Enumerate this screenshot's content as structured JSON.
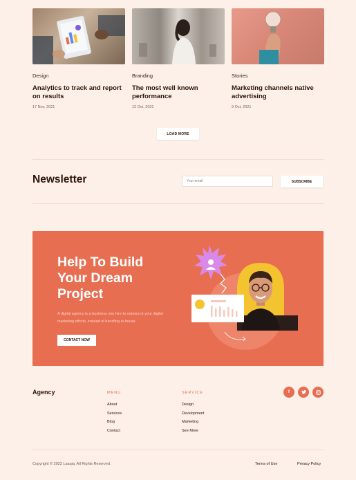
{
  "articles": [
    {
      "category": "Design",
      "title": "Analytics to track and report on results",
      "date": "17 Nov, 2021",
      "image": "tablet-analytics-photo"
    },
    {
      "category": "Branding",
      "title": "The most well known performance",
      "date": "12 Oct, 2021",
      "image": "woman-back-photo"
    },
    {
      "category": "Stories",
      "title": "Marketing channels native advertising",
      "date": "9 Oct, 2021",
      "image": "lightbulb-hand-photo"
    }
  ],
  "load_more": "LOAD MORE",
  "newsletter": {
    "title": "Newsletter",
    "placeholder": "Your email",
    "button": "SUBSCRIBE"
  },
  "cta": {
    "title": "Help To Build Your Dream Project",
    "text": "A digital agency is a business you hire to outsource your digital marketing efforts, instead of handling in-house.",
    "button": "CONTACT NOW"
  },
  "footer": {
    "brand": "Agency",
    "menu": {
      "heading": "MENU",
      "links": [
        "About",
        "Services",
        "Blog",
        "Contact"
      ]
    },
    "service": {
      "heading": "SERVICE",
      "links": [
        "Design",
        "Development",
        "Marketing",
        "See More"
      ]
    },
    "socials": [
      "facebook-icon",
      "twitter-icon",
      "instagram-icon"
    ],
    "copyright": "Copyright © 2022 Laaqiq. All Rights Reserved.",
    "terms": "Terms of Use",
    "privacy": "Privacy Policy"
  },
  "colors": {
    "accent": "#e86e52",
    "background": "#fdf0e8",
    "text": "#2b1408",
    "yellow": "#f4c430",
    "purple": "#d98ae8"
  }
}
